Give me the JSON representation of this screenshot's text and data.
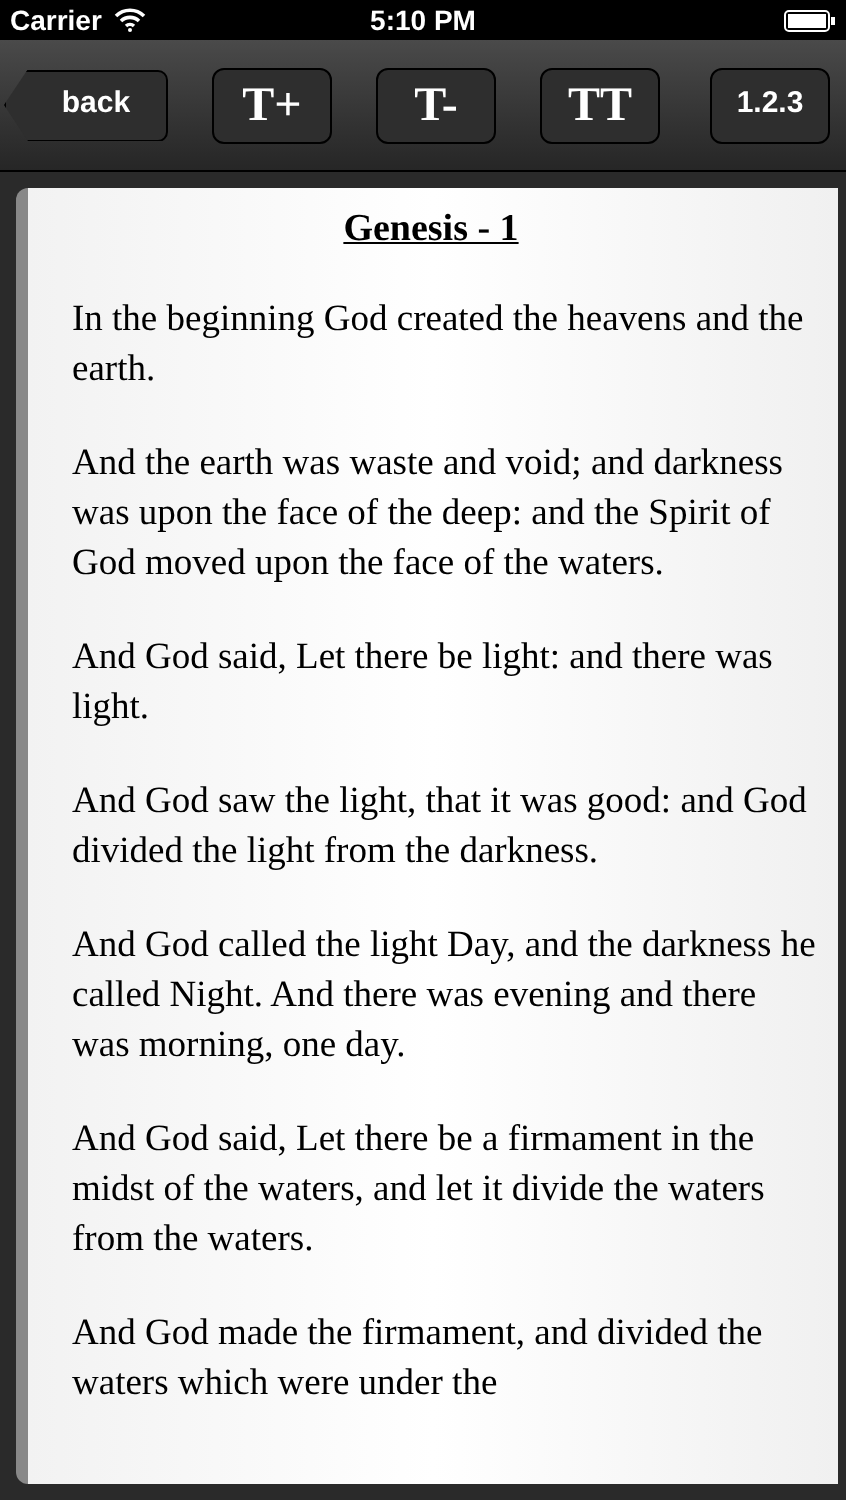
{
  "status_bar": {
    "carrier": "Carrier",
    "time": "5:10 PM"
  },
  "toolbar": {
    "back": "back",
    "buttons": [
      {
        "kind": "serif",
        "label": "T+"
      },
      {
        "kind": "serif",
        "label": "T-"
      },
      {
        "kind": "serif",
        "label": "TT"
      },
      {
        "kind": "sans",
        "label": "1.2.3"
      }
    ]
  },
  "chapter_title": "Genesis - 1",
  "verses": [
    "In the beginning God created the heavens and the earth.",
    "And the earth was waste and void; and darkness was upon the face of the deep: and the Spirit of God moved upon the face of the waters.",
    "And God said, Let there be light: and there was light.",
    "And God saw the light, that it was good: and God divided the light from the darkness.",
    "And God called the light Day, and the darkness he called Night. And there was evening and there was morning, one day.",
    "And God said, Let there be a firmament in the midst of the waters, and let it divide the waters from the waters.",
    "And God made the firmament, and divided the waters which were under the"
  ]
}
